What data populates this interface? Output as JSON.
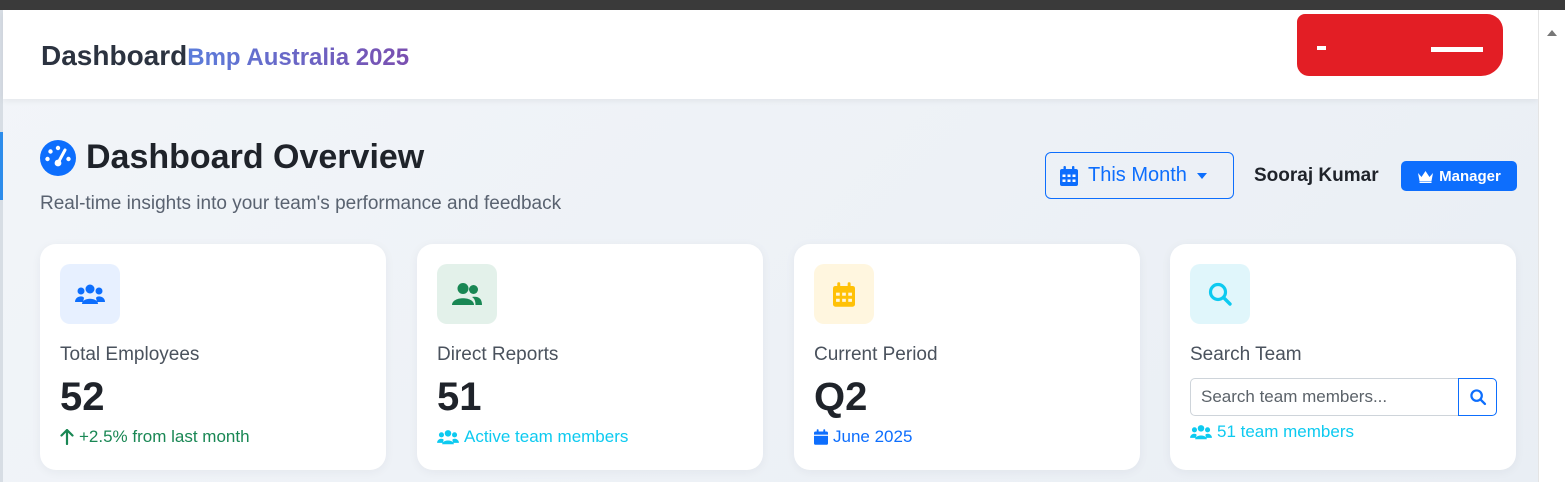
{
  "topbar": {
    "brand": "Dashboard",
    "org": "Bmp Australia 2025"
  },
  "hero": {
    "title": "Dashboard Overview",
    "subtitle": "Real-time insights into your team's performance and feedback",
    "icon": "gauge-icon"
  },
  "controls": {
    "period_label": "This Month",
    "user_name": "Sooraj Kumar",
    "role": "Manager"
  },
  "cards": [
    {
      "label": "Total Employees",
      "value": "52",
      "meta": "+2.5% from last month",
      "icon": "users-icon",
      "meta_icon": "arrow-up-icon"
    },
    {
      "label": "Direct Reports",
      "value": "51",
      "meta": "Active team members",
      "icon": "user-group-icon",
      "meta_icon": "users-icon"
    },
    {
      "label": "Current Period",
      "value": "Q2",
      "meta": "June 2025",
      "icon": "calendar-icon",
      "meta_icon": "calendar-icon"
    },
    {
      "label": "Search Team",
      "meta": "51 team members",
      "icon": "search-icon",
      "meta_icon": "users-icon"
    }
  ],
  "search": {
    "placeholder": "Search team members...",
    "value": ""
  },
  "colors": {
    "primary": "#0d6efd",
    "success": "#198754",
    "info": "#0dcaf0",
    "warning": "#ffc107",
    "tile_blue": "#e7f0ff",
    "tile_green": "#e3f1ea",
    "tile_yellow": "#fff6df",
    "tile_cyan": "#e0f6fb",
    "redaction": "#e31e25"
  }
}
